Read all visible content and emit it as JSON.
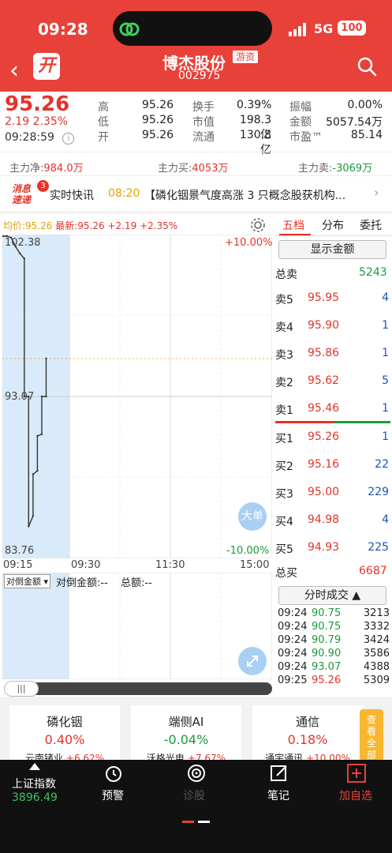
{
  "status": {
    "time": "09:28",
    "network": "5G",
    "battery": "100"
  },
  "header": {
    "kai_label": "开",
    "name": "博杰股份",
    "tag": "游资",
    "code": "002975"
  },
  "quote": {
    "price": "95.26",
    "change": "2.19",
    "change_pct": "2.35%",
    "time": "09:28:59",
    "grid": [
      {
        "l": "高",
        "v": "95.26",
        "l2": "换手",
        "v2": "0.39%",
        "l3": "振幅",
        "v3": "0.00%"
      },
      {
        "l": "低",
        "v": "95.26",
        "l2": "市值",
        "v2": "198.3亿",
        "l3": "金额",
        "v3": "5057.54万"
      },
      {
        "l": "开",
        "v": "95.26",
        "l2": "流通",
        "v2": "130.8亿",
        "l3": "市盈™",
        "v3": "85.14"
      }
    ],
    "flow": {
      "net_label": "主力净:",
      "net": "984.0万",
      "buy_label": "主力买:",
      "buy": "4053万",
      "sell_label": "主力卖:",
      "sell": "-3069万"
    }
  },
  "news": {
    "logo": "消息速递",
    "badge": "3",
    "title": "实时快讯",
    "time": "08:20",
    "text": "【磷化铟景气度高涨 3 只概念股获机构..."
  },
  "chart_head": {
    "avg": "均价:95.26",
    "latest": "最新:95.26",
    "chg": "+2.19",
    "pct": "+2.35%"
  },
  "chart_data": {
    "type": "line",
    "title": "",
    "x_ticks": [
      "09:15",
      "09:30",
      "11:30",
      "15:00"
    ],
    "y_left": [
      "102.38",
      "93.07",
      "83.76"
    ],
    "y_right": [
      "+10.00%",
      "-10.00%"
    ],
    "ylim": [
      83.76,
      102.38
    ],
    "series": [
      {
        "x": [
          "09:15",
          "09:16",
          "09:17",
          "09:18",
          "09:19",
          "09:20",
          "09:20",
          "09:21",
          "09:21",
          "09:22",
          "09:22",
          "09:23",
          "09:23",
          "09:24",
          "09:24",
          "09:25",
          "09:25"
        ],
        "y": [
          102.38,
          102.38,
          102.2,
          101.7,
          101.3,
          101.0,
          93.07,
          93.07,
          85.6,
          86.2,
          88.6,
          88.8,
          90.8,
          90.9,
          93.07,
          93.07,
          95.26
        ]
      }
    ]
  },
  "buttons": {
    "big_order": "大单",
    "dual_amount": "对倒金额",
    "dual_amount2": "对倒金额:--",
    "total_amount": "总额:--",
    "show_amount": "显示金额",
    "time_sales": "分时成交 ▲"
  },
  "tabs": [
    "五档",
    "分布",
    "委托"
  ],
  "orderbook": {
    "sell_total_label": "总卖",
    "sell_total": "5243",
    "sells": [
      {
        "l": "卖5",
        "p": "95.95",
        "v": "4"
      },
      {
        "l": "卖4",
        "p": "95.90",
        "v": "1"
      },
      {
        "l": "卖3",
        "p": "95.86",
        "v": "1"
      },
      {
        "l": "卖2",
        "p": "95.62",
        "v": "5"
      },
      {
        "l": "卖1",
        "p": "95.46",
        "v": "1"
      }
    ],
    "buys": [
      {
        "l": "买1",
        "p": "95.26",
        "v": "1"
      },
      {
        "l": "买2",
        "p": "95.16",
        "v": "22"
      },
      {
        "l": "买3",
        "p": "95.00",
        "v": "229"
      },
      {
        "l": "买4",
        "p": "94.98",
        "v": "4"
      },
      {
        "l": "买5",
        "p": "94.93",
        "v": "225"
      }
    ],
    "buy_total_label": "总买",
    "buy_total": "6687"
  },
  "ticks": [
    {
      "t": "09:24",
      "p": "90.75",
      "v": "3213",
      "c": "green"
    },
    {
      "t": "09:24",
      "p": "90.75",
      "v": "3332",
      "c": "green"
    },
    {
      "t": "09:24",
      "p": "90.79",
      "v": "3424",
      "c": "green"
    },
    {
      "t": "09:24",
      "p": "90.90",
      "v": "3586",
      "c": "green"
    },
    {
      "t": "09:24",
      "p": "93.07",
      "v": "4388",
      "c": "green"
    },
    {
      "t": "09:25",
      "p": "95.26",
      "v": "5309",
      "c": "red"
    }
  ],
  "cards": [
    {
      "name": "磷化铟",
      "pct": "0.40%",
      "sub": "云南锗业",
      "sub_pct": "+6.62%",
      "c": "red"
    },
    {
      "name": "端侧AI",
      "pct": "-0.04%",
      "sub": "沃格光电",
      "sub_pct": "+7.67%",
      "c": "green"
    },
    {
      "name": "通信",
      "pct": "0.18%",
      "sub": "通宇通讯",
      "sub_pct": "+10.00%",
      "c": "red"
    }
  ],
  "see_all": "查看全部",
  "bottom_nav": {
    "index_name": "上证指数",
    "index_value": "3896.49",
    "alert": "预警",
    "center": "诊股",
    "notes": "笔记",
    "add": "加自选"
  },
  "colors": {
    "red": "#e5332a",
    "green": "#1a9a3b",
    "header": "#e8413a",
    "blue": "#1e52b6"
  }
}
